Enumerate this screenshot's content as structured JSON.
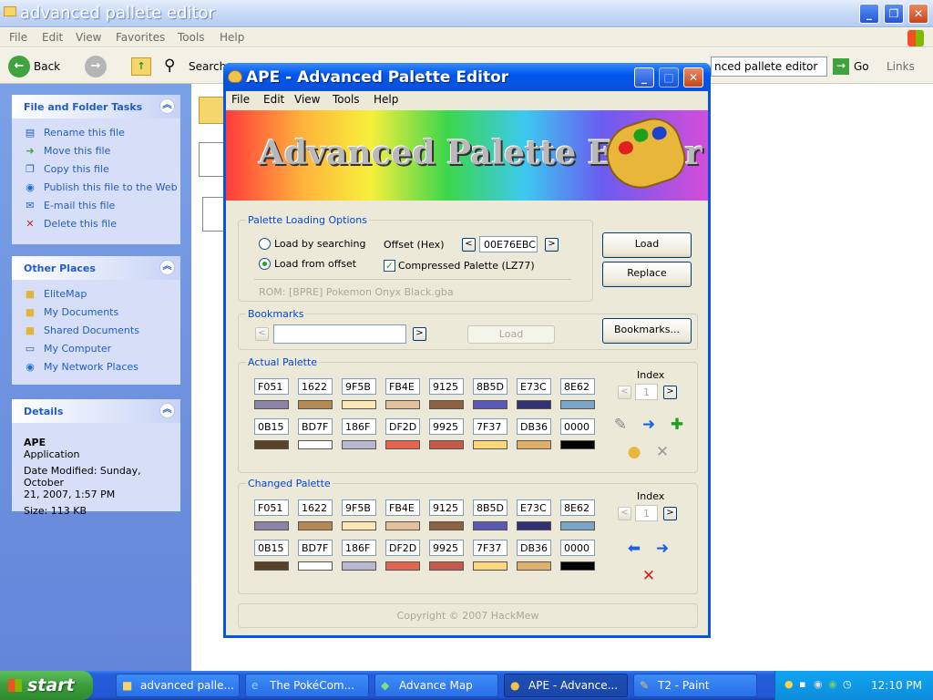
{
  "explorer": {
    "title": "advanced pallete editor",
    "menu": [
      "File",
      "Edit",
      "View",
      "Favorites",
      "Tools",
      "Help"
    ],
    "toolbar": {
      "back": "Back",
      "search": "Search",
      "address_tail": "nced pallete editor",
      "go": "Go",
      "links": "Links"
    },
    "tasks_panel": {
      "header": "File and Folder Tasks",
      "items": [
        "Rename this file",
        "Move this file",
        "Copy this file",
        "Publish this file to the Web",
        "E-mail this file",
        "Delete this file"
      ]
    },
    "places_panel": {
      "header": "Other Places",
      "items": [
        "EliteMap",
        "My Documents",
        "Shared Documents",
        "My Computer",
        "My Network Places"
      ]
    },
    "details_panel": {
      "header": "Details",
      "name": "APE",
      "type": "Application",
      "modified_line1": "Date Modified: Sunday, October",
      "modified_line2": "21, 2007, 1:57 PM",
      "size": "Size: 113 KB"
    }
  },
  "ape": {
    "title": "APE - Advanced Palette Editor",
    "menu": [
      "File",
      "Edit",
      "View",
      "Tools",
      "Help"
    ],
    "banner": "Advanced Palette Editor",
    "loading": {
      "label": "Palette Loading Options",
      "opt_search": "Load by searching",
      "opt_offset": "Load from offset",
      "offset_label": "Offset (Hex)",
      "offset_value": "00E76EBC",
      "compressed": "Compressed Palette (LZ77)",
      "rom": "ROM: [BPRE] Pokemon Onyx Black.gba",
      "load_btn": "Load",
      "replace_btn": "Replace"
    },
    "bookmarks": {
      "label": "Bookmarks",
      "load_btn": "Load",
      "bookmarks_btn": "Bookmarks...",
      "prev": "<",
      "next": ">"
    },
    "actual": {
      "label": "Actual Palette",
      "index_label": "Index",
      "index_value": "1",
      "row1": [
        "F051",
        "1622",
        "9F5B",
        "FB4E",
        "9125",
        "8B5D",
        "E73C",
        "8E62"
      ],
      "row2": [
        "0B15",
        "BD7F",
        "186F",
        "DF2D",
        "9925",
        "7F37",
        "DB36",
        "0000"
      ]
    },
    "changed": {
      "label": "Changed Palette",
      "index_label": "Index",
      "index_value": "1",
      "row1": [
        "F051",
        "1622",
        "9F5B",
        "FB4E",
        "9125",
        "8B5D",
        "E73C",
        "8E62"
      ],
      "row2": [
        "0B15",
        "BD7F",
        "186F",
        "DF2D",
        "9925",
        "7F37",
        "DB36",
        "0000"
      ]
    },
    "swatch_colors": {
      "row1": [
        "#8c84a4",
        "#b58952",
        "#fde7b5",
        "#e4c09c",
        "#8c6242",
        "#5a5ab5",
        "#313173",
        "#7ba5c6"
      ],
      "row2": [
        "#5a4229",
        "#ffffff",
        "#b8b8d0",
        "#e46452",
        "#c65a4a",
        "#ffd77b",
        "#deb06b",
        "#000000"
      ]
    },
    "copyright": "Copyright © 2007 HackMew"
  },
  "taskbar": {
    "start": "start",
    "tasks": [
      "advanced palle...",
      "The PokéCom...",
      "Advance Map",
      "APE - Advance...",
      "T2 - Paint"
    ],
    "time": "12:10 PM"
  }
}
